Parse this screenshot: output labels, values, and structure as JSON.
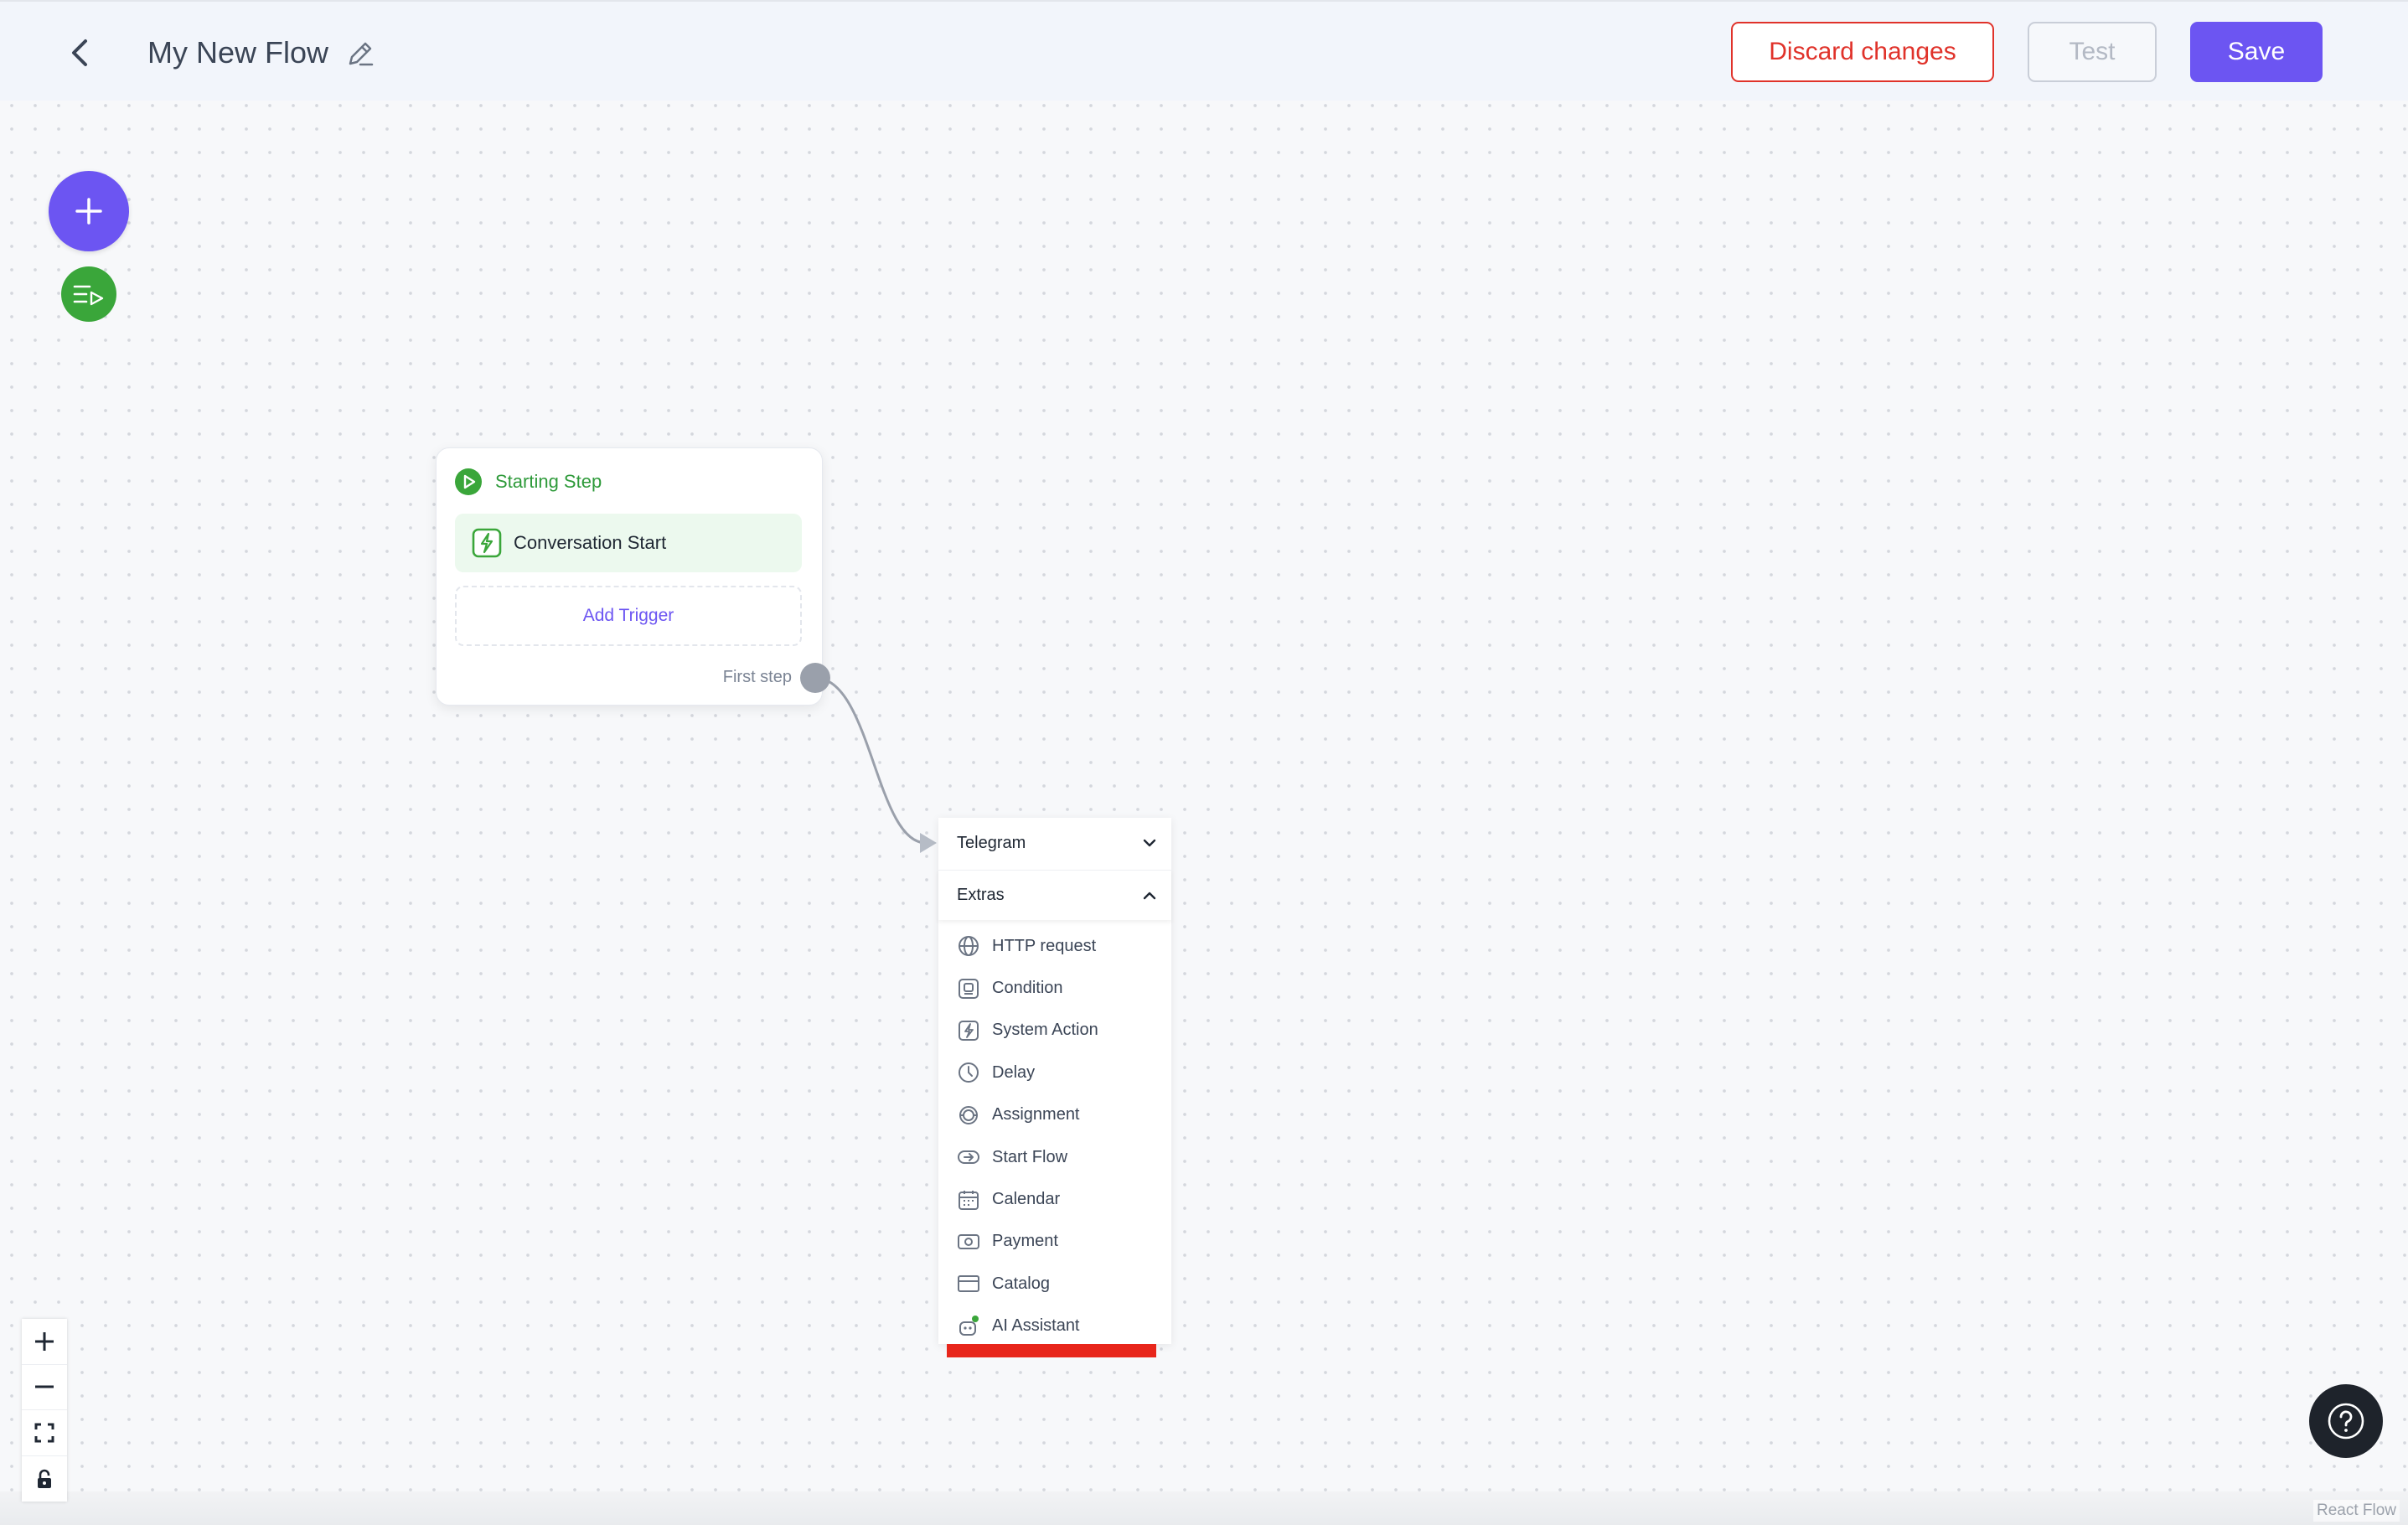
{
  "header": {
    "title": "My New Flow",
    "discard_label": "Discard changes",
    "test_label": "Test",
    "save_label": "Save"
  },
  "colors": {
    "accent": "#6c55f2",
    "danger": "#e0322a",
    "success": "#3aa63a"
  },
  "node": {
    "title": "Starting Step",
    "trigger_label": "Conversation Start",
    "add_trigger_label": "Add Trigger",
    "handle_label": "First step"
  },
  "menu": {
    "sections": [
      {
        "label": "Telegram",
        "expanded": false
      },
      {
        "label": "Extras",
        "expanded": true
      }
    ],
    "items": [
      {
        "label": "HTTP request",
        "icon": "globe-icon"
      },
      {
        "label": "Condition",
        "icon": "condition-icon"
      },
      {
        "label": "System Action",
        "icon": "bolt-icon"
      },
      {
        "label": "Delay",
        "icon": "clock-icon"
      },
      {
        "label": "Assignment",
        "icon": "assignment-icon"
      },
      {
        "label": "Start Flow",
        "icon": "start-flow-icon"
      },
      {
        "label": "Calendar",
        "icon": "calendar-icon"
      },
      {
        "label": "Payment",
        "icon": "payment-icon"
      },
      {
        "label": "Catalog",
        "icon": "catalog-icon"
      },
      {
        "label": "AI Assistant",
        "icon": "ai-assistant-icon"
      }
    ]
  },
  "attribution": "React Flow"
}
